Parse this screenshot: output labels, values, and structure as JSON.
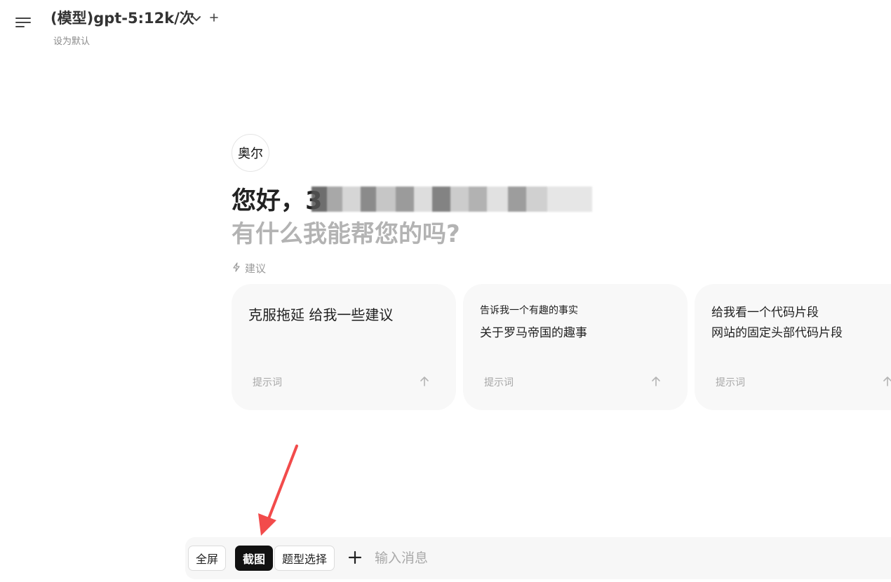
{
  "header": {
    "model_title": "(模型)gpt-5:12k/次",
    "set_default": "设为默认"
  },
  "greeting": {
    "avatar_text": "奥尔",
    "hello": "您好，3",
    "question": "有什么我能帮您的吗?"
  },
  "suggestions": {
    "label": "建议",
    "tag": "提示词",
    "cards": [
      {
        "line1": "克服拖延 给我一些建议",
        "line2": ""
      },
      {
        "line1": "告诉我一个有趣的事实",
        "line2": "关于罗马帝国的趣事"
      },
      {
        "line1": "给我看一个代码片段",
        "line2": "网站的固定头部代码片段"
      }
    ]
  },
  "input": {
    "chips": [
      "全屏",
      "截图",
      "题型选择"
    ],
    "active_chip": "截图",
    "placeholder": "输入消息"
  },
  "colors": {
    "annotation_arrow": "#f24b4b",
    "active_chip_bg": "#111111",
    "card_bg": "#f8f8f8"
  },
  "icons": [
    "menu-icon",
    "chevron-down-icon",
    "plus-icon",
    "bolt-icon",
    "arrow-up-icon"
  ]
}
